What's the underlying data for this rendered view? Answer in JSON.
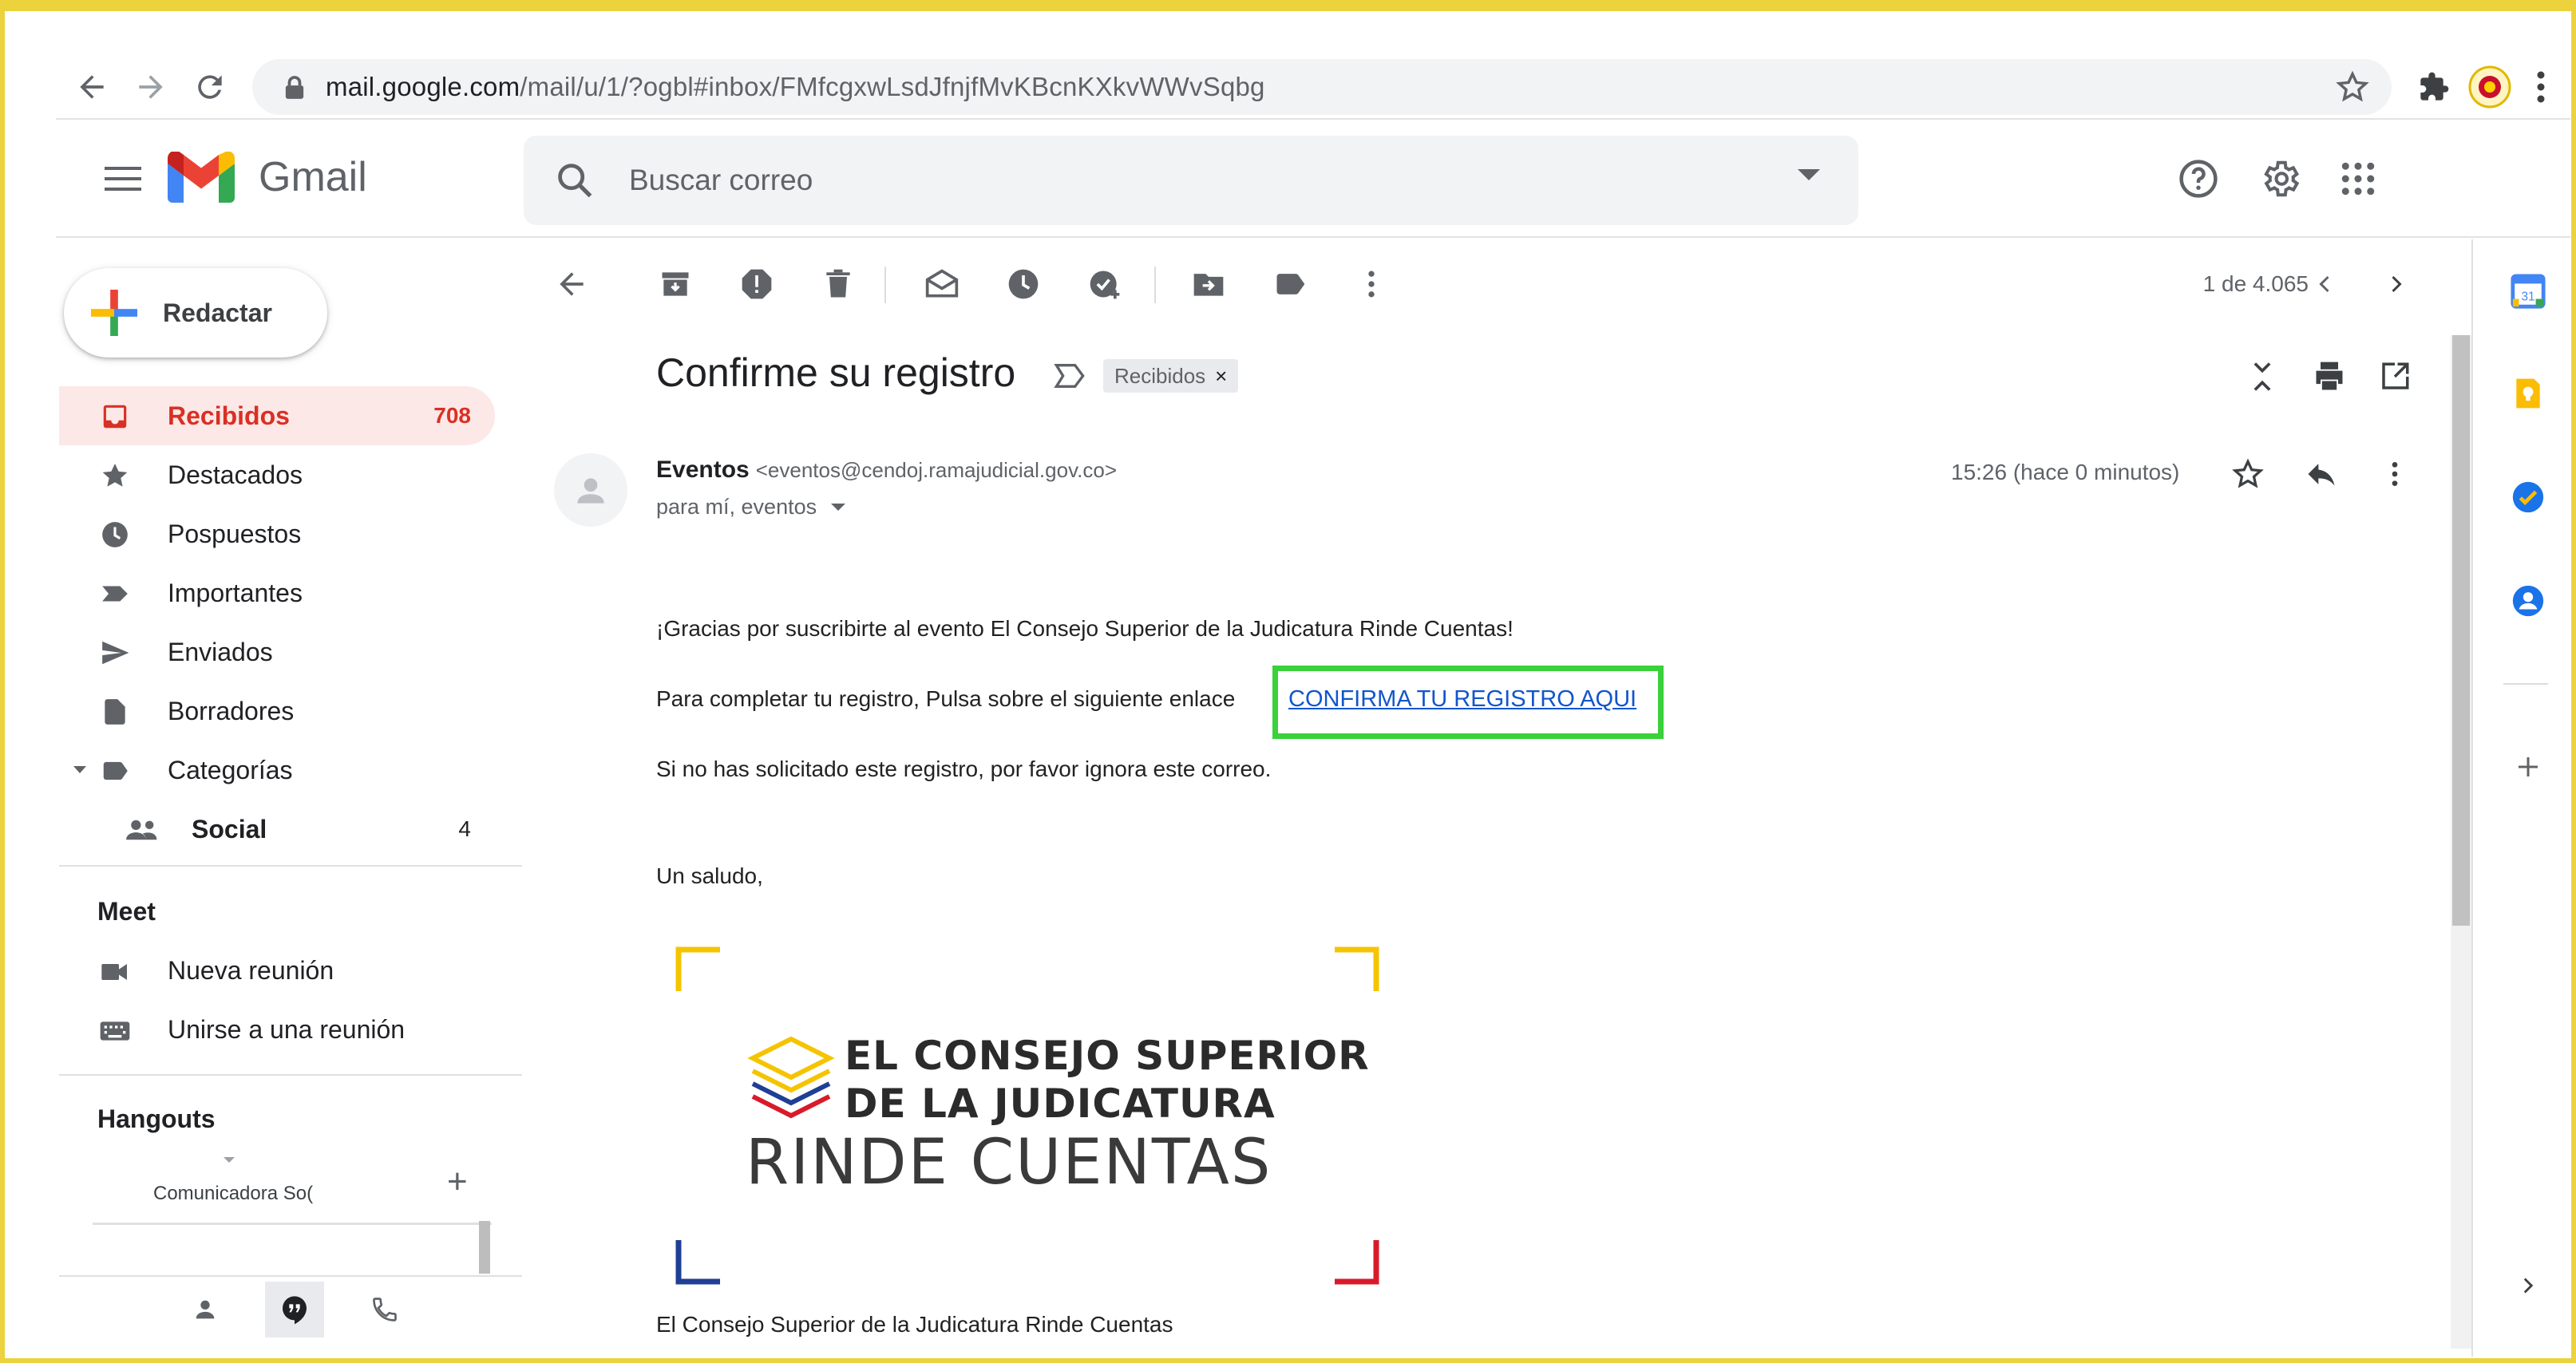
{
  "browser": {
    "url_host": "mail.google.com",
    "url_path": "/mail/u/1/?ogbl#inbox/FMfcgxwLsdJfnjfMvKBcnKXkvWWvSqbg"
  },
  "header": {
    "app_name": "Gmail",
    "search_placeholder": "Buscar correo"
  },
  "sidebar": {
    "compose_label": "Redactar",
    "items": [
      {
        "label": "Recibidos",
        "count": "708",
        "icon": "inbox-icon"
      },
      {
        "label": "Destacados",
        "count": "",
        "icon": "star-icon"
      },
      {
        "label": "Pospuestos",
        "count": "",
        "icon": "clock-icon"
      },
      {
        "label": "Importantes",
        "count": "",
        "icon": "important-icon"
      },
      {
        "label": "Enviados",
        "count": "",
        "icon": "send-icon"
      },
      {
        "label": "Borradores",
        "count": "",
        "icon": "draft-icon"
      },
      {
        "label": "Categorías",
        "count": "",
        "icon": "label-icon"
      },
      {
        "label": "Social",
        "count": "4",
        "icon": "people-icon"
      }
    ],
    "meet_title": "Meet",
    "meet_items": [
      {
        "label": "Nueva reunión",
        "icon": "video-icon"
      },
      {
        "label": "Unirse a una reunión",
        "icon": "keyboard-icon"
      }
    ],
    "hangouts_title": "Hangouts",
    "hangouts_user": "Comunicadora So("
  },
  "toolbar": {
    "pager": "1 de 4.065"
  },
  "message": {
    "subject": "Confirme su registro",
    "label_chip": "Recibidos",
    "chip_close": "×",
    "sender_name": "Eventos",
    "sender_email": "<eventos@cendoj.ramajudicial.gov.co>",
    "to_line": "para mí, eventos",
    "time": "15:26 (hace 0 minutos)",
    "line1": "¡Gracias por suscribirte al evento El Consejo Superior de la Judicatura Rinde Cuentas!",
    "line2": "Para completar tu registro, Pulsa sobre el siguiente enlace",
    "cta_link": "CONFIRMA TU REGISTRO AQUI",
    "line3": "Si no has solicitado este registro, por favor ignora este correo.",
    "greeting": "Un saludo,",
    "logo_line1": "EL CONSEJO SUPERIOR",
    "logo_line2": "DE LA JUDICATURA",
    "logo_line3": "RINDE CUENTAS",
    "footer": "El Consejo Superior de la Judicatura Rinde Cuentas"
  },
  "colors": {
    "accent_red": "#d93025",
    "link_blue": "#1155cc",
    "highlight_green": "#3ad13a",
    "frame_yellow": "#ecd23c"
  }
}
